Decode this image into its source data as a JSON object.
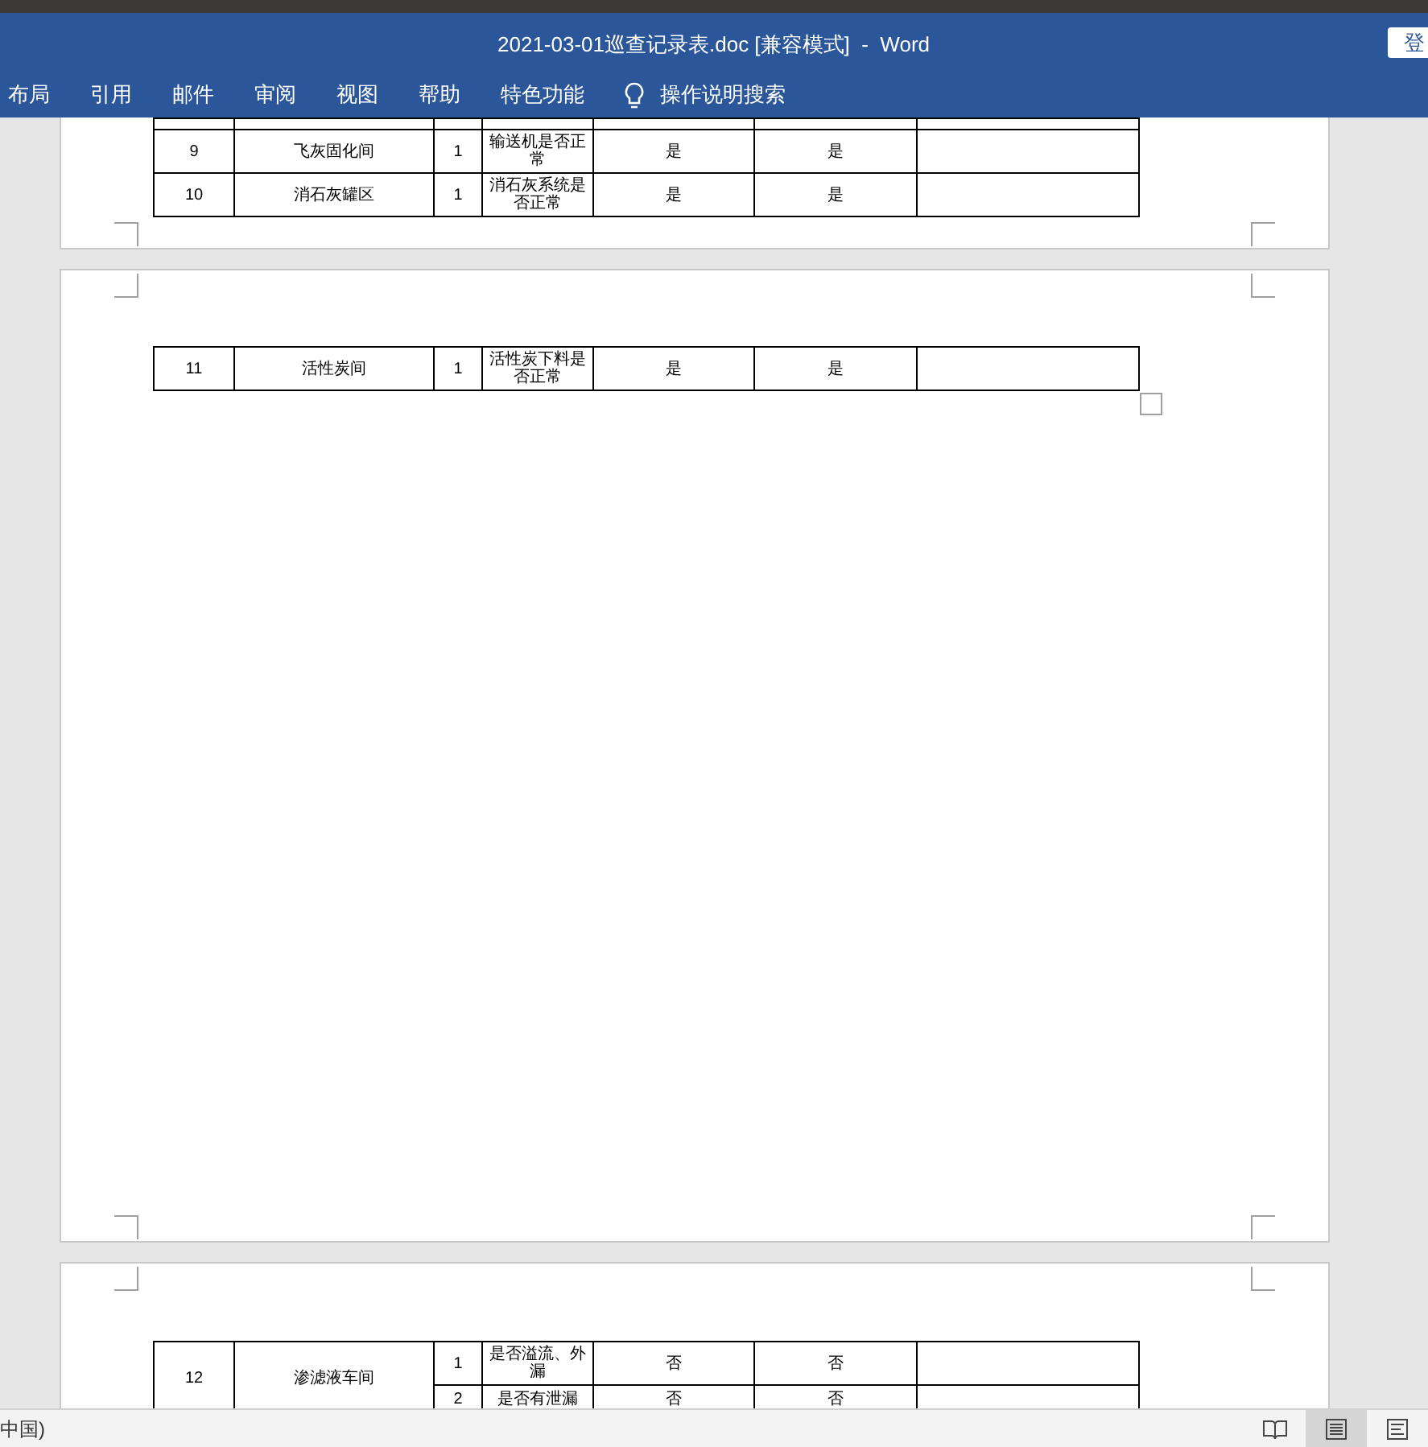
{
  "window": {
    "title": "2021-03-01巡查记录表.doc [兼容模式]  -  Word",
    "sign_in": "登"
  },
  "ribbon_tabs": [
    {
      "label": "布局"
    },
    {
      "label": "引用"
    },
    {
      "label": "邮件"
    },
    {
      "label": "审阅"
    },
    {
      "label": "视图"
    },
    {
      "label": "帮助"
    },
    {
      "label": "特色功能"
    }
  ],
  "tell_me": {
    "placeholder": "操作说明搜索"
  },
  "pages": [
    {
      "top_cut": true,
      "rows": [
        {
          "number": "9",
          "area": "飞灰固化间",
          "items": [
            {
              "number": "1",
              "question": "输送机是否正常",
              "column_5": "是",
              "column_6": "是"
            }
          ]
        },
        {
          "number": "10",
          "area": "消石灰罐区",
          "items": [
            {
              "number": "1",
              "question": "消石灰系统是否正常",
              "column_5": "是",
              "column_6": "是"
            }
          ]
        }
      ]
    },
    {
      "rows": [
        {
          "number": "11",
          "area": "活性炭间",
          "items": [
            {
              "number": "1",
              "question": "活性炭下料是否正常",
              "column_5": "是",
              "column_6": "是"
            }
          ]
        }
      ]
    },
    {
      "rows": [
        {
          "number": "12",
          "area": "渗滤液车间",
          "items": [
            {
              "number": "1",
              "question": "是否溢流、外漏",
              "column_5": "否",
              "column_6": "否"
            },
            {
              "number": "2",
              "question": "是否有泄漏",
              "column_5": "否",
              "column_6": "否"
            }
          ]
        }
      ]
    }
  ],
  "status_bar": {
    "language": "中国)",
    "views": [
      {
        "kind": "read",
        "selected": false
      },
      {
        "kind": "print",
        "selected": true
      },
      {
        "kind": "web",
        "selected": false
      }
    ]
  }
}
